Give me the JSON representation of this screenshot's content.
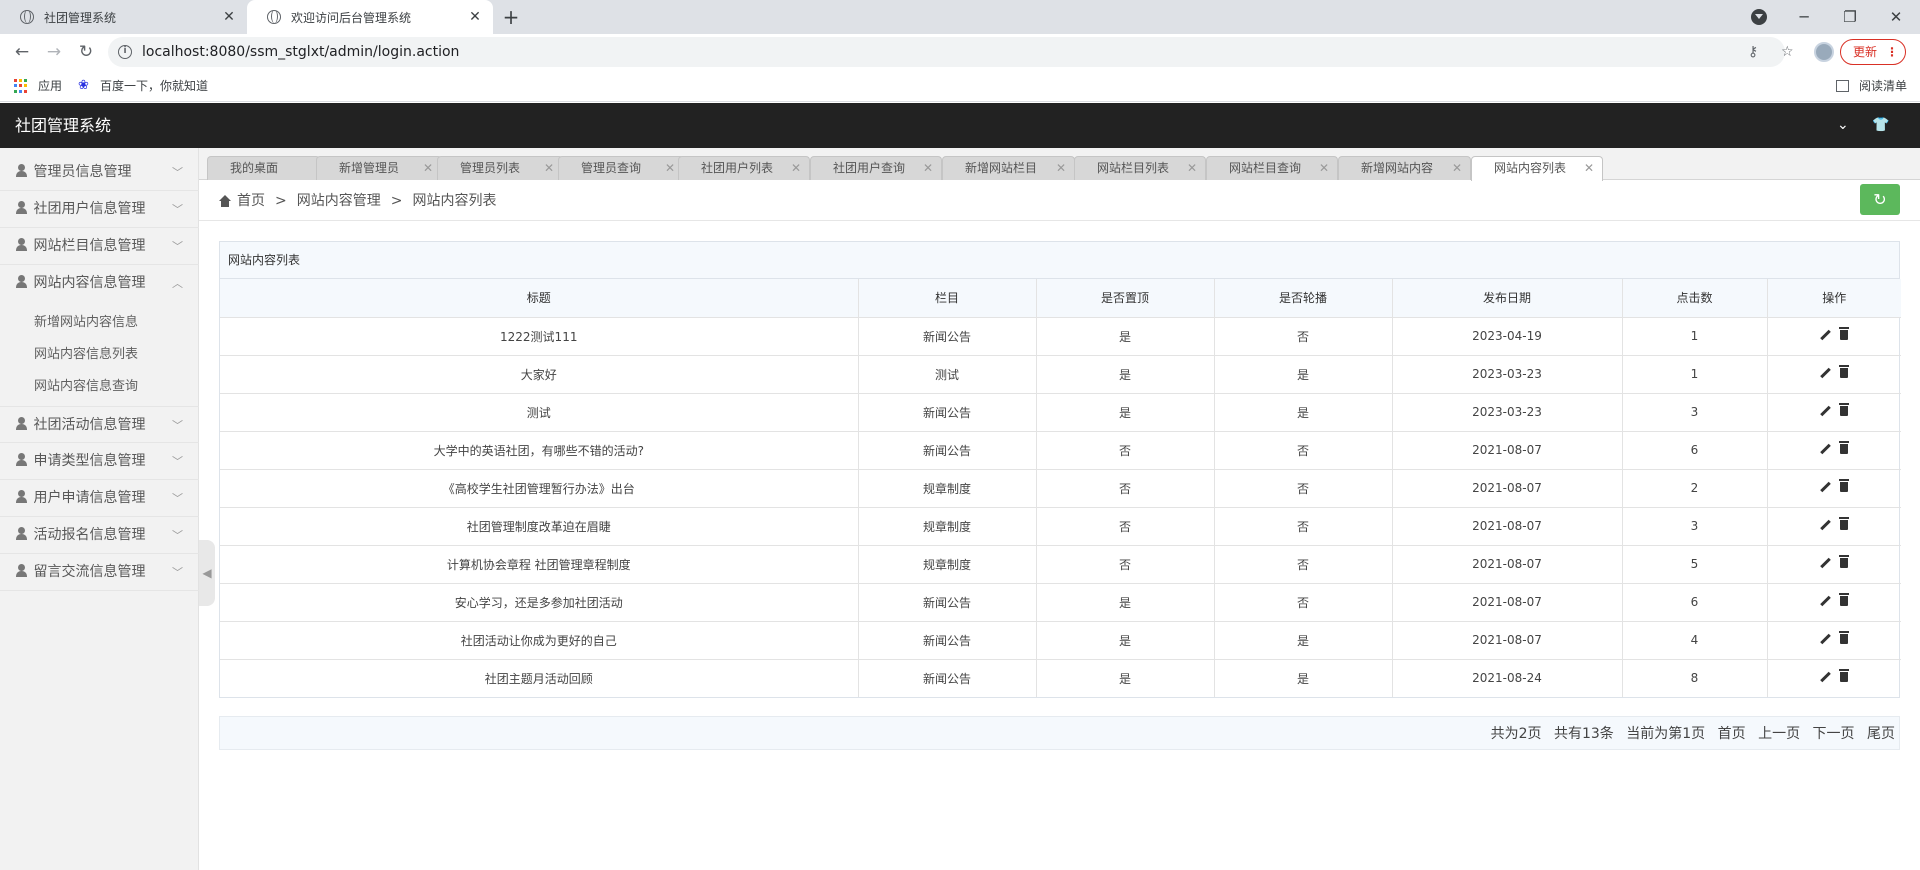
{
  "browser": {
    "tabs": [
      {
        "title": "社团管理系统"
      },
      {
        "title": "欢迎访问后台管理系统"
      }
    ],
    "url": "localhost:8080/ssm_stglxt/admin/login.action",
    "update_label": "更新",
    "bookmarks": {
      "apps": "应用",
      "baidu": "百度一下，你就知道",
      "reading_list": "阅读清单"
    }
  },
  "app": {
    "title": "社团管理系统"
  },
  "sidebar": {
    "items": [
      {
        "label": "管理员信息管理"
      },
      {
        "label": "社团用户信息管理"
      },
      {
        "label": "网站栏目信息管理"
      },
      {
        "label": "网站内容信息管理"
      },
      {
        "label": "社团活动信息管理"
      },
      {
        "label": "申请类型信息管理"
      },
      {
        "label": "用户申请信息管理"
      },
      {
        "label": "活动报名信息管理"
      },
      {
        "label": "留言交流信息管理"
      }
    ],
    "subitems": [
      {
        "label": "新增网站内容信息"
      },
      {
        "label": "网站内容信息列表"
      },
      {
        "label": "网站内容信息查询"
      }
    ]
  },
  "content_tabs": [
    {
      "label": "我的桌面"
    },
    {
      "label": "新增管理员"
    },
    {
      "label": "管理员列表"
    },
    {
      "label": "管理员查询"
    },
    {
      "label": "社团用户列表"
    },
    {
      "label": "社团用户查询"
    },
    {
      "label": "新增网站栏目"
    },
    {
      "label": "网站栏目列表"
    },
    {
      "label": "网站栏目查询"
    },
    {
      "label": "新增网站内容"
    },
    {
      "label": "网站内容列表"
    }
  ],
  "breadcrumb": {
    "home": "首页",
    "parent": "网站内容管理",
    "current": "网站内容列表",
    "sep": ">"
  },
  "panel": {
    "title": "网站内容列表"
  },
  "table": {
    "headers": [
      "标题",
      "栏目",
      "是否置顶",
      "是否轮播",
      "发布日期",
      "点击数",
      "操作"
    ],
    "rows": [
      [
        "1222测试111",
        "新闻公告",
        "是",
        "否",
        "2023-04-19",
        "1"
      ],
      [
        "大家好",
        "测试",
        "是",
        "是",
        "2023-03-23",
        "1"
      ],
      [
        "测试",
        "新闻公告",
        "是",
        "是",
        "2023-03-23",
        "3"
      ],
      [
        "大学中的英语社团，有哪些不错的活动?",
        "新闻公告",
        "否",
        "否",
        "2021-08-07",
        "6"
      ],
      [
        "《高校学生社团管理暂行办法》出台",
        "规章制度",
        "否",
        "否",
        "2021-08-07",
        "2"
      ],
      [
        "社团管理制度改革迫在眉睫",
        "规章制度",
        "否",
        "否",
        "2021-08-07",
        "3"
      ],
      [
        "计算机协会章程 社团管理章程制度",
        "规章制度",
        "否",
        "否",
        "2021-08-07",
        "5"
      ],
      [
        "安心学习，还是多参加社团活动",
        "新闻公告",
        "是",
        "否",
        "2021-08-07",
        "6"
      ],
      [
        "社团活动让你成为更好的自己",
        "新闻公告",
        "是",
        "是",
        "2021-08-07",
        "4"
      ],
      [
        "社团主题月活动回顾",
        "新闻公告",
        "是",
        "是",
        "2021-08-24",
        "8"
      ]
    ]
  },
  "pager": {
    "total_pages": "共为2页",
    "total_records": "共有13条",
    "current": "当前为第1页",
    "first": "首页",
    "prev": "上一页",
    "next": "下一页",
    "last": "尾页"
  }
}
